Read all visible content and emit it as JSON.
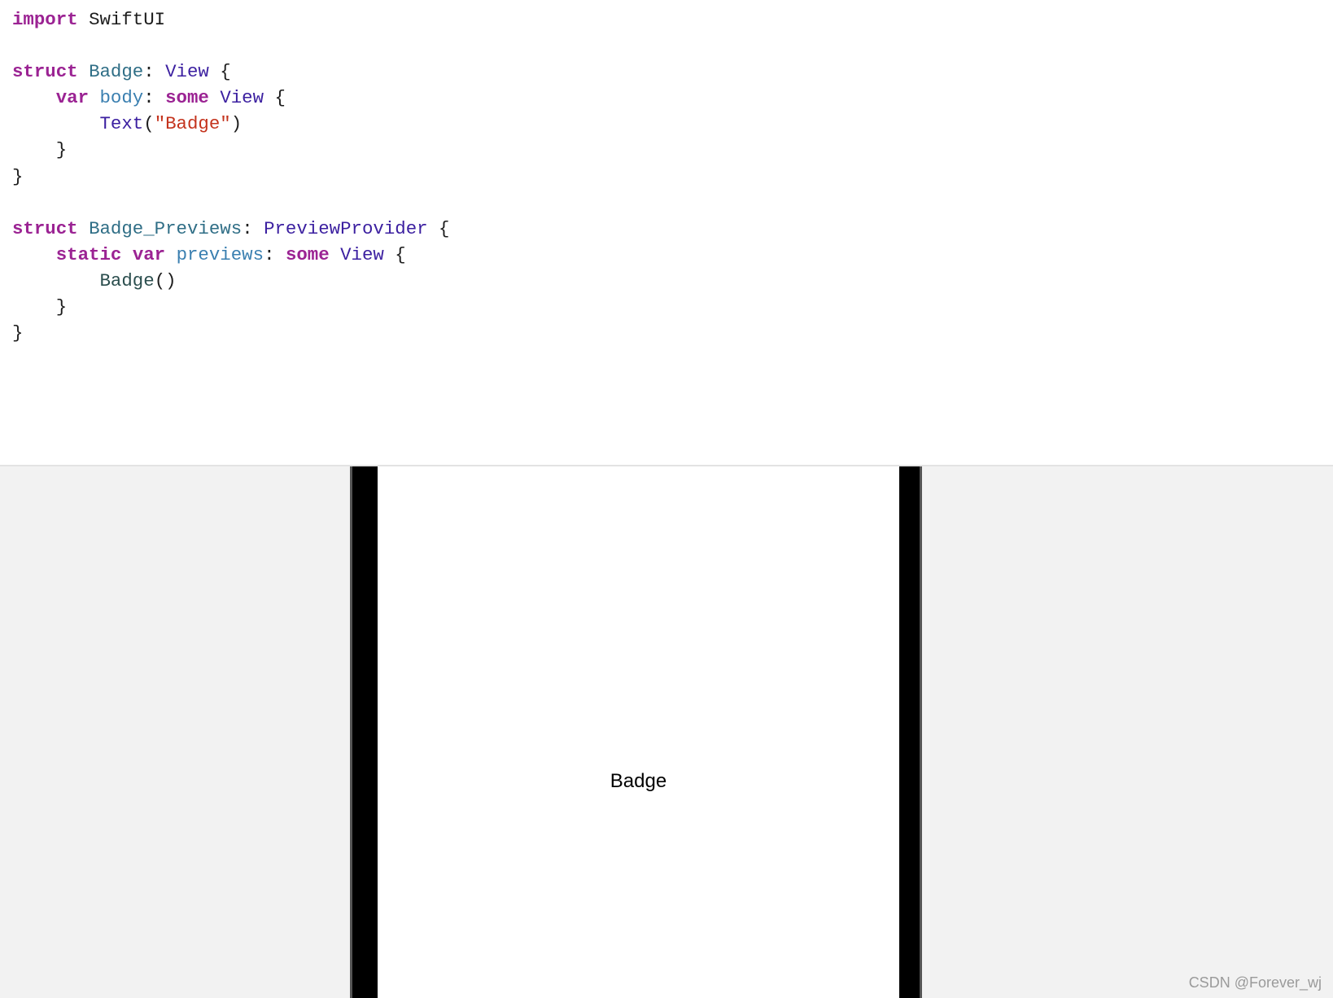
{
  "code": {
    "import_kw": "import",
    "import_mod": "SwiftUI",
    "struct_kw": "struct",
    "badge_name": "Badge",
    "view_type": "View",
    "var_kw": "var",
    "body_prop": "body",
    "some_kw": "some",
    "text_type": "Text",
    "badge_string": "\"Badge\"",
    "previews_name": "Badge_Previews",
    "preview_provider": "PreviewProvider",
    "static_kw": "static",
    "previews_prop": "previews",
    "badge_call": "Badge"
  },
  "preview": {
    "text": "Badge"
  },
  "watermark": "CSDN @Forever_wj",
  "colors": {
    "keyword": "#9b2393",
    "string": "#c4331d",
    "system_type": "#3b1fa0",
    "canvas_background": "#f2f2f2"
  }
}
